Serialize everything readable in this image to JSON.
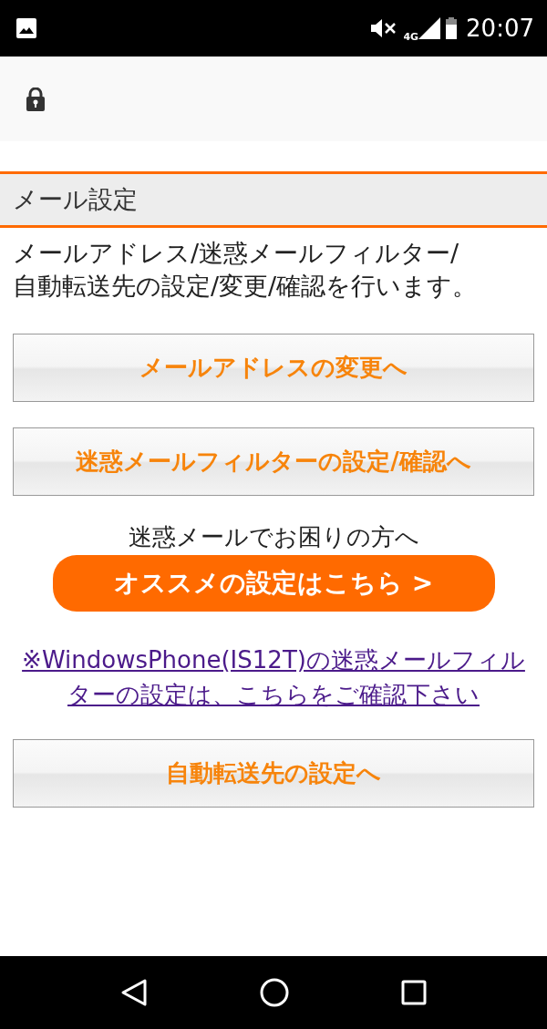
{
  "status_bar": {
    "network": "4G",
    "time": "20:07"
  },
  "section": {
    "title": "メール設定"
  },
  "description": "メールアドレス/迷惑メールフィルター/自動転送先の設定/変更/確認を行います。",
  "buttons": [
    {
      "label": "メールアドレスの変更へ"
    },
    {
      "label": "迷惑メールフィルターの設定/確認へ"
    }
  ],
  "promo": {
    "caption": "迷惑メールでお困りの方へ",
    "button": "オススメの設定はこちら >"
  },
  "link": "※WindowsPhone(IS12T)の迷惑メールフィルターの設定は、こちらをご確認下さい",
  "bottom_button": {
    "label": "自動転送先の設定へ"
  }
}
